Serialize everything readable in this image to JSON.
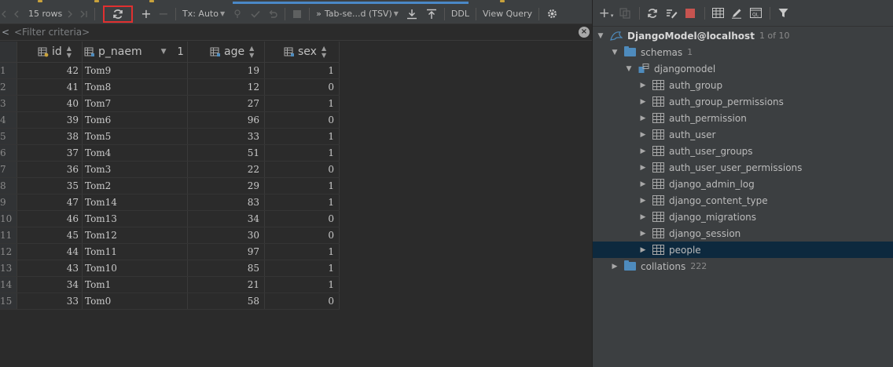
{
  "toolbar": {
    "rows_label": "15 rows",
    "tx_label": "Tx: Auto",
    "format_label": "Tab-se...d (TSV)",
    "ddl_label": "DDL",
    "view_query_label": "View Query"
  },
  "filter": {
    "lt_glyph": "<",
    "placeholder": "<Filter criteria>",
    "clear_glyph": "×"
  },
  "table": {
    "columns": [
      {
        "name": "id"
      },
      {
        "name": "p_naem",
        "sort_order": "1"
      },
      {
        "name": "age"
      },
      {
        "name": "sex"
      }
    ],
    "rows": [
      {
        "num": "1",
        "id": "42",
        "p_naem": "Tom9",
        "age": "19",
        "sex": "1"
      },
      {
        "num": "2",
        "id": "41",
        "p_naem": "Tom8",
        "age": "12",
        "sex": "0"
      },
      {
        "num": "3",
        "id": "40",
        "p_naem": "Tom7",
        "age": "27",
        "sex": "1"
      },
      {
        "num": "4",
        "id": "39",
        "p_naem": "Tom6",
        "age": "96",
        "sex": "0"
      },
      {
        "num": "5",
        "id": "38",
        "p_naem": "Tom5",
        "age": "33",
        "sex": "1"
      },
      {
        "num": "6",
        "id": "37",
        "p_naem": "Tom4",
        "age": "51",
        "sex": "1"
      },
      {
        "num": "7",
        "id": "36",
        "p_naem": "Tom3",
        "age": "22",
        "sex": "0"
      },
      {
        "num": "8",
        "id": "35",
        "p_naem": "Tom2",
        "age": "29",
        "sex": "1"
      },
      {
        "num": "9",
        "id": "47",
        "p_naem": "Tom14",
        "age": "83",
        "sex": "1"
      },
      {
        "num": "10",
        "id": "46",
        "p_naem": "Tom13",
        "age": "34",
        "sex": "0"
      },
      {
        "num": "11",
        "id": "45",
        "p_naem": "Tom12",
        "age": "30",
        "sex": "0"
      },
      {
        "num": "12",
        "id": "44",
        "p_naem": "Tom11",
        "age": "97",
        "sex": "1"
      },
      {
        "num": "13",
        "id": "43",
        "p_naem": "Tom10",
        "age": "85",
        "sex": "1"
      },
      {
        "num": "14",
        "id": "34",
        "p_naem": "Tom1",
        "age": "21",
        "sex": "1"
      },
      {
        "num": "15",
        "id": "33",
        "p_naem": "Tom0",
        "age": "58",
        "sex": "0"
      }
    ]
  },
  "tree": {
    "root": {
      "label": "DjangoModel@localhost",
      "badge": "1 of 10"
    },
    "schemas": {
      "label": "schemas",
      "badge": "1"
    },
    "schema": {
      "label": "djangomodel"
    },
    "tables": [
      "auth_group",
      "auth_group_permissions",
      "auth_permission",
      "auth_user",
      "auth_user_groups",
      "auth_user_user_permissions",
      "django_admin_log",
      "django_content_type",
      "django_migrations",
      "django_session",
      "people"
    ],
    "selected_table": "people",
    "collations": {
      "label": "collations",
      "badge": "222"
    }
  },
  "colors": {
    "background": "#2b2b2b",
    "panel": "#3c3f41",
    "selection": "#0d293e",
    "highlight_box": "#e03030",
    "stop_red": "#c75450",
    "folder_blue": "#4e8bbd",
    "key_icon_gold": "#c9a23b"
  },
  "icons": {
    "toolbar": [
      "first-page-icon",
      "prev-page-icon",
      "next-page-icon",
      "last-page-icon",
      "refresh-icon",
      "add-row-icon",
      "delete-row-icon",
      "commit-icon",
      "rollback-icon",
      "stop-icon",
      "export-icon",
      "import-icon",
      "settings-icon"
    ],
    "db_explorer": [
      "add-icon",
      "copy-icon",
      "refresh-icon",
      "edit-icon",
      "stop-icon",
      "table-icon",
      "pencil-icon",
      "console-icon",
      "filter-icon"
    ]
  }
}
